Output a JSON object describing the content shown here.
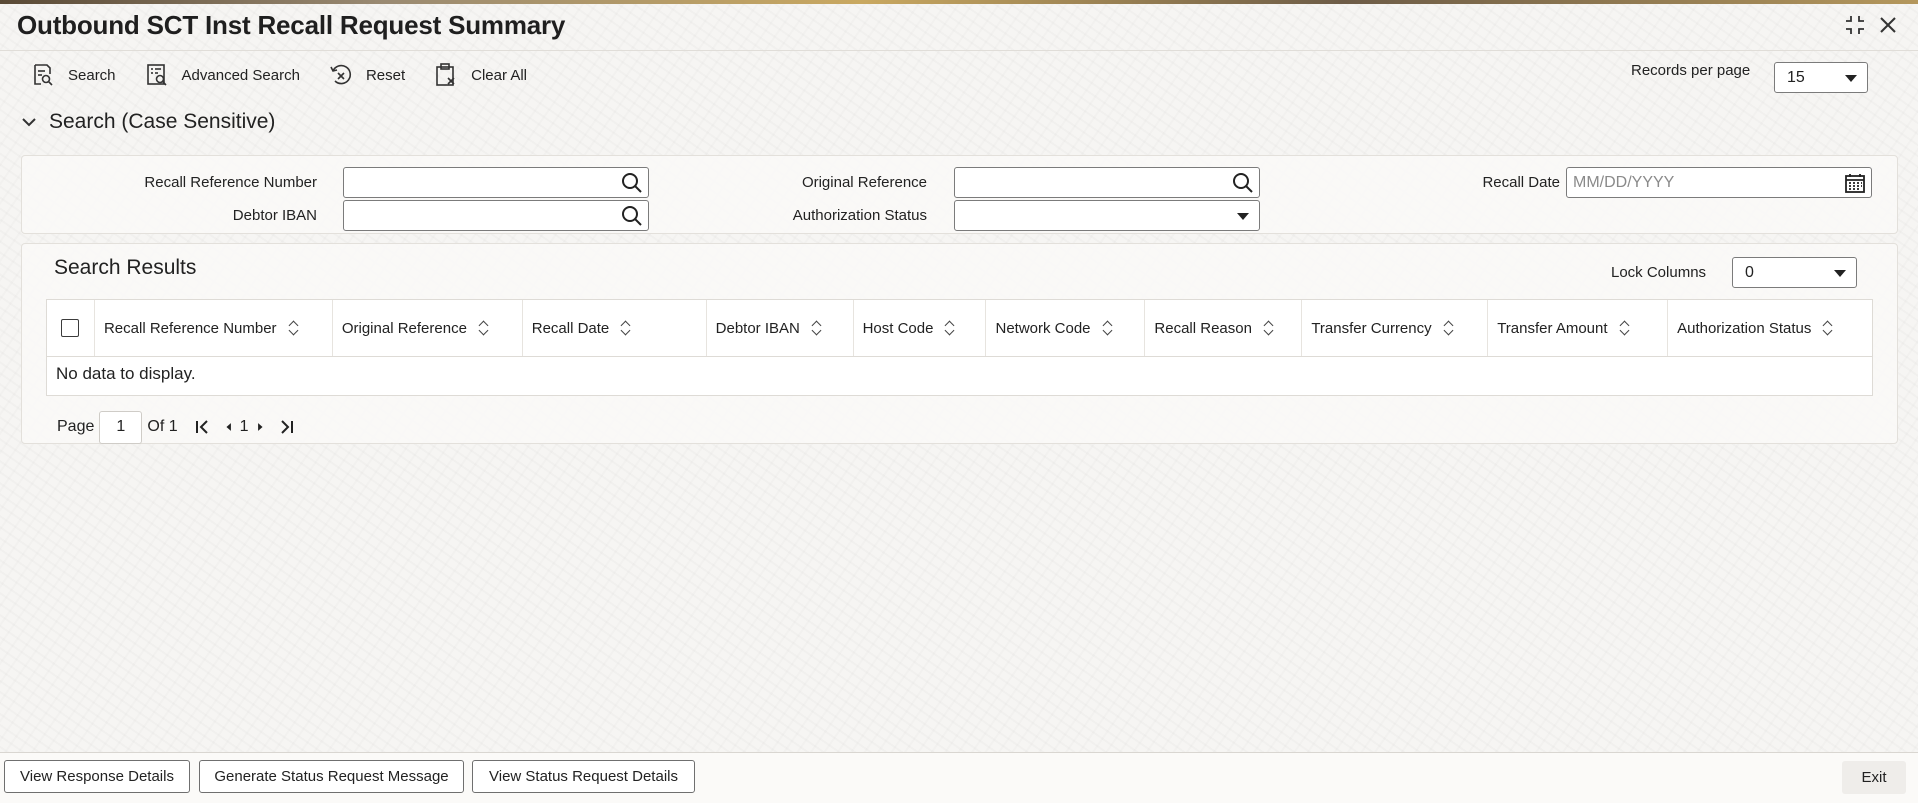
{
  "window": {
    "title": "Outbound SCT Inst Recall Request Summary",
    "controls": [
      "minimize-icon",
      "close-icon"
    ]
  },
  "toolbar": {
    "search_label": "Search",
    "advanced_search_label": "Advanced Search",
    "reset_label": "Reset",
    "clear_all_label": "Clear All",
    "records_per_page_label": "Records per page",
    "records_per_page_value": "15"
  },
  "search_section": {
    "title": "Search (Case Sensitive)",
    "fields": {
      "recall_reference_number": {
        "label": "Recall Reference Number",
        "value": ""
      },
      "original_reference": {
        "label": "Original Reference",
        "value": ""
      },
      "recall_date": {
        "label": "Recall Date",
        "value": "",
        "placeholder": "MM/DD/YYYY"
      },
      "debtor_iban": {
        "label": "Debtor IBAN",
        "value": ""
      },
      "authorization_status": {
        "label": "Authorization Status",
        "value": ""
      }
    }
  },
  "results": {
    "title": "Search Results",
    "lock_columns_label": "Lock Columns",
    "lock_columns_value": "0",
    "columns": [
      "Recall Reference Number",
      "Original Reference",
      "Recall Date",
      "Debtor IBAN",
      "Host Code",
      "Network Code",
      "Recall Reason",
      "Transfer Currency",
      "Transfer Amount",
      "Authorization Status"
    ],
    "rows": [],
    "empty_message": "No data to display."
  },
  "pagination": {
    "page_label": "Page",
    "current_page": "1",
    "of_label": "Of 1",
    "page_number": "1"
  },
  "footer": {
    "view_response_details": "View Response Details",
    "generate_status_request_message": "Generate Status Request Message",
    "view_status_request_details": "View Status Request Details",
    "exit": "Exit"
  }
}
